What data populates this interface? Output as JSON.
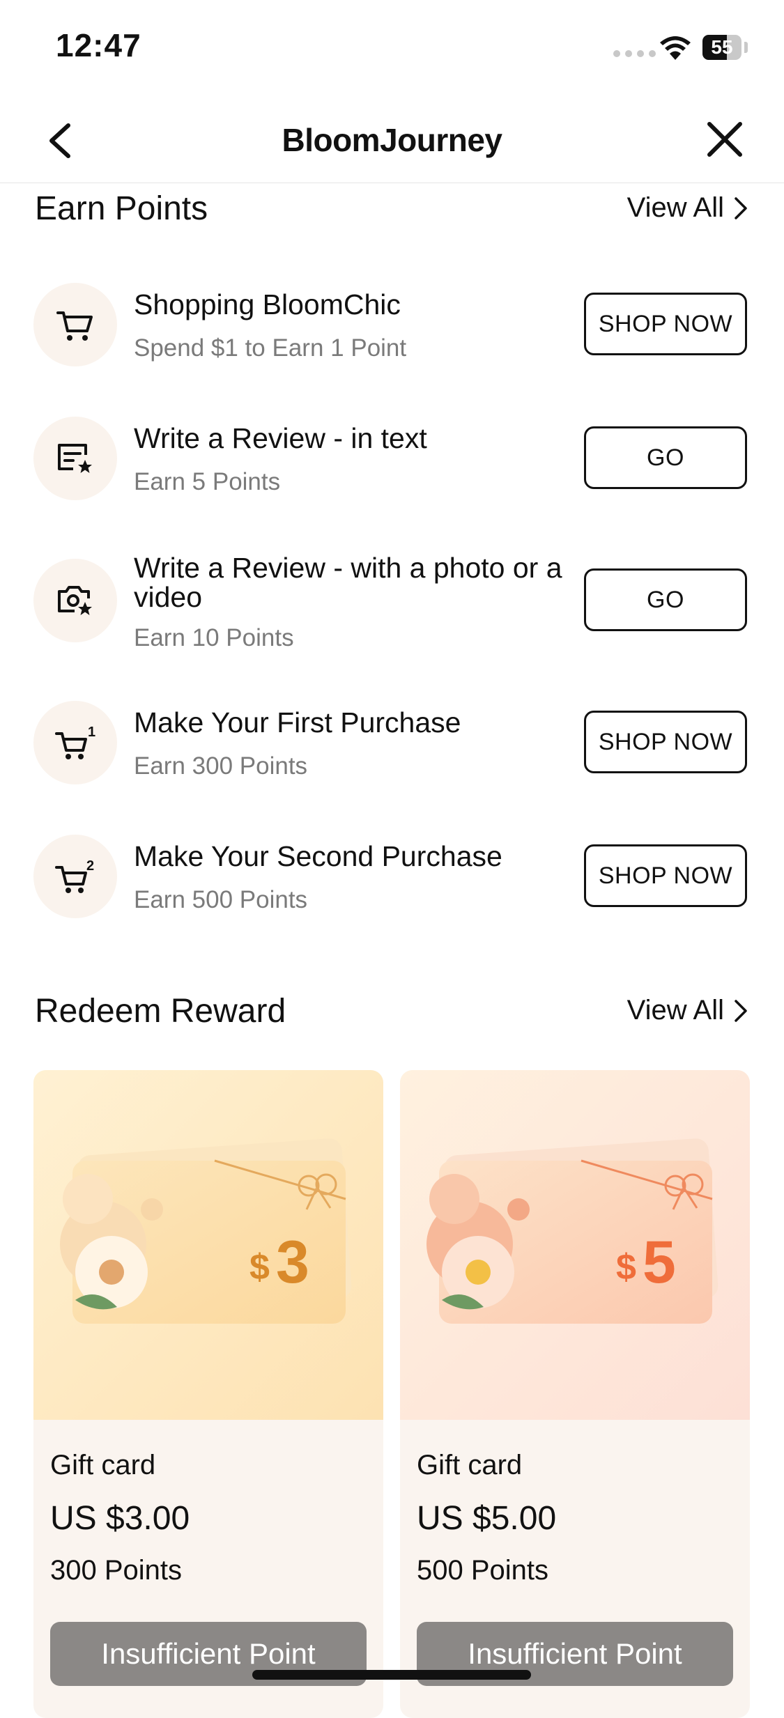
{
  "status": {
    "time": "12:47",
    "battery": "55"
  },
  "nav": {
    "title": "BloomJourney"
  },
  "earn": {
    "title": "Earn Points",
    "view_all": "View All",
    "tasks": [
      {
        "icon": "cart-icon",
        "title": "Shopping BloomChic",
        "sub": "Spend $1 to Earn 1 Point",
        "button": "SHOP NOW"
      },
      {
        "icon": "review-text-icon",
        "title": "Write a Review - in text",
        "sub": "Earn 5 Points",
        "button": "GO"
      },
      {
        "icon": "review-photo-icon",
        "title": "Write a Review - with a photo or a video",
        "sub": "Earn 10 Points",
        "button": "GO"
      },
      {
        "icon": "cart-first-icon",
        "title": "Make Your First Purchase",
        "sub": "Earn 300 Points",
        "button": "SHOP NOW"
      },
      {
        "icon": "cart-second-icon",
        "title": "Make Your Second Purchase",
        "sub": "Earn 500 Points",
        "button": "SHOP NOW"
      }
    ]
  },
  "redeem": {
    "title": "Redeem Reward",
    "view_all": "View All",
    "cards": [
      {
        "card_symbol": "$",
        "card_amount": "3",
        "type": "Gift card",
        "price": "US $3.00",
        "points": "300 Points",
        "button": "Insufficient Point",
        "accent": "#d9892a"
      },
      {
        "card_symbol": "$",
        "card_amount": "5",
        "type": "Gift card",
        "price": "US $5.00",
        "points": "500 Points",
        "button": "Insufficient Point",
        "accent": "#ef6d3a"
      }
    ]
  },
  "colors": {
    "icon_bg": "#faf3ed",
    "card_bg": "#faf4ef",
    "disabled_button": "#8b8886"
  }
}
